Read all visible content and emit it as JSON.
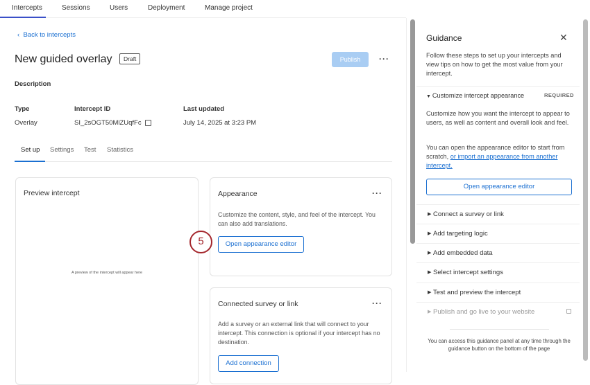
{
  "topnav": [
    "Intercepts",
    "Sessions",
    "Users",
    "Deployment",
    "Manage project"
  ],
  "back": "Back to intercepts",
  "title": "New guided overlay",
  "status": "Draft",
  "publish": "Publish",
  "description_label": "Description",
  "meta": {
    "type_label": "Type",
    "type": "Overlay",
    "id_label": "Intercept ID",
    "id": "SI_2sOGT50MlZUqfFc",
    "updated_label": "Last updated",
    "updated": "July 14, 2025 at 3:23 PM"
  },
  "tabs": [
    "Set up",
    "Settings",
    "Test",
    "Statistics"
  ],
  "preview": {
    "title": "Preview intercept",
    "placeholder": "A preview of the intercept will appear here"
  },
  "appearance": {
    "title": "Appearance",
    "text": "Customize the content, style, and feel of the intercept. You can also add translations.",
    "button": "Open appearance editor"
  },
  "step_marker": "5",
  "connected": {
    "title": "Connected survey or link",
    "text": "Add a survey or an external link that will connect to your intercept. This connection is optional if your intercept has no destination.",
    "button": "Add connection"
  },
  "guidance": {
    "title": "Guidance",
    "intro": "Follow these steps to set up your intercepts and view tips on how to get the most value from your intercept.",
    "step1": {
      "label": "Customize intercept appearance",
      "badge": "REQUIRED",
      "text1": "Customize how you want the intercept to appear to users, as well as content and overall look and feel.",
      "text2": "You can open the appearance editor to start from scratch,",
      "link": "or import an appearance from another intercept.",
      "button": "Open appearance editor"
    },
    "steps": [
      "Connect a survey or link",
      "Add targeting logic",
      "Add embedded data",
      "Select intercept settings",
      "Test and preview the intercept"
    ],
    "locked_step": "Publish and go live to your website",
    "footer": "You can access this guidance panel at any time through the guidance button on the bottom of the page"
  }
}
